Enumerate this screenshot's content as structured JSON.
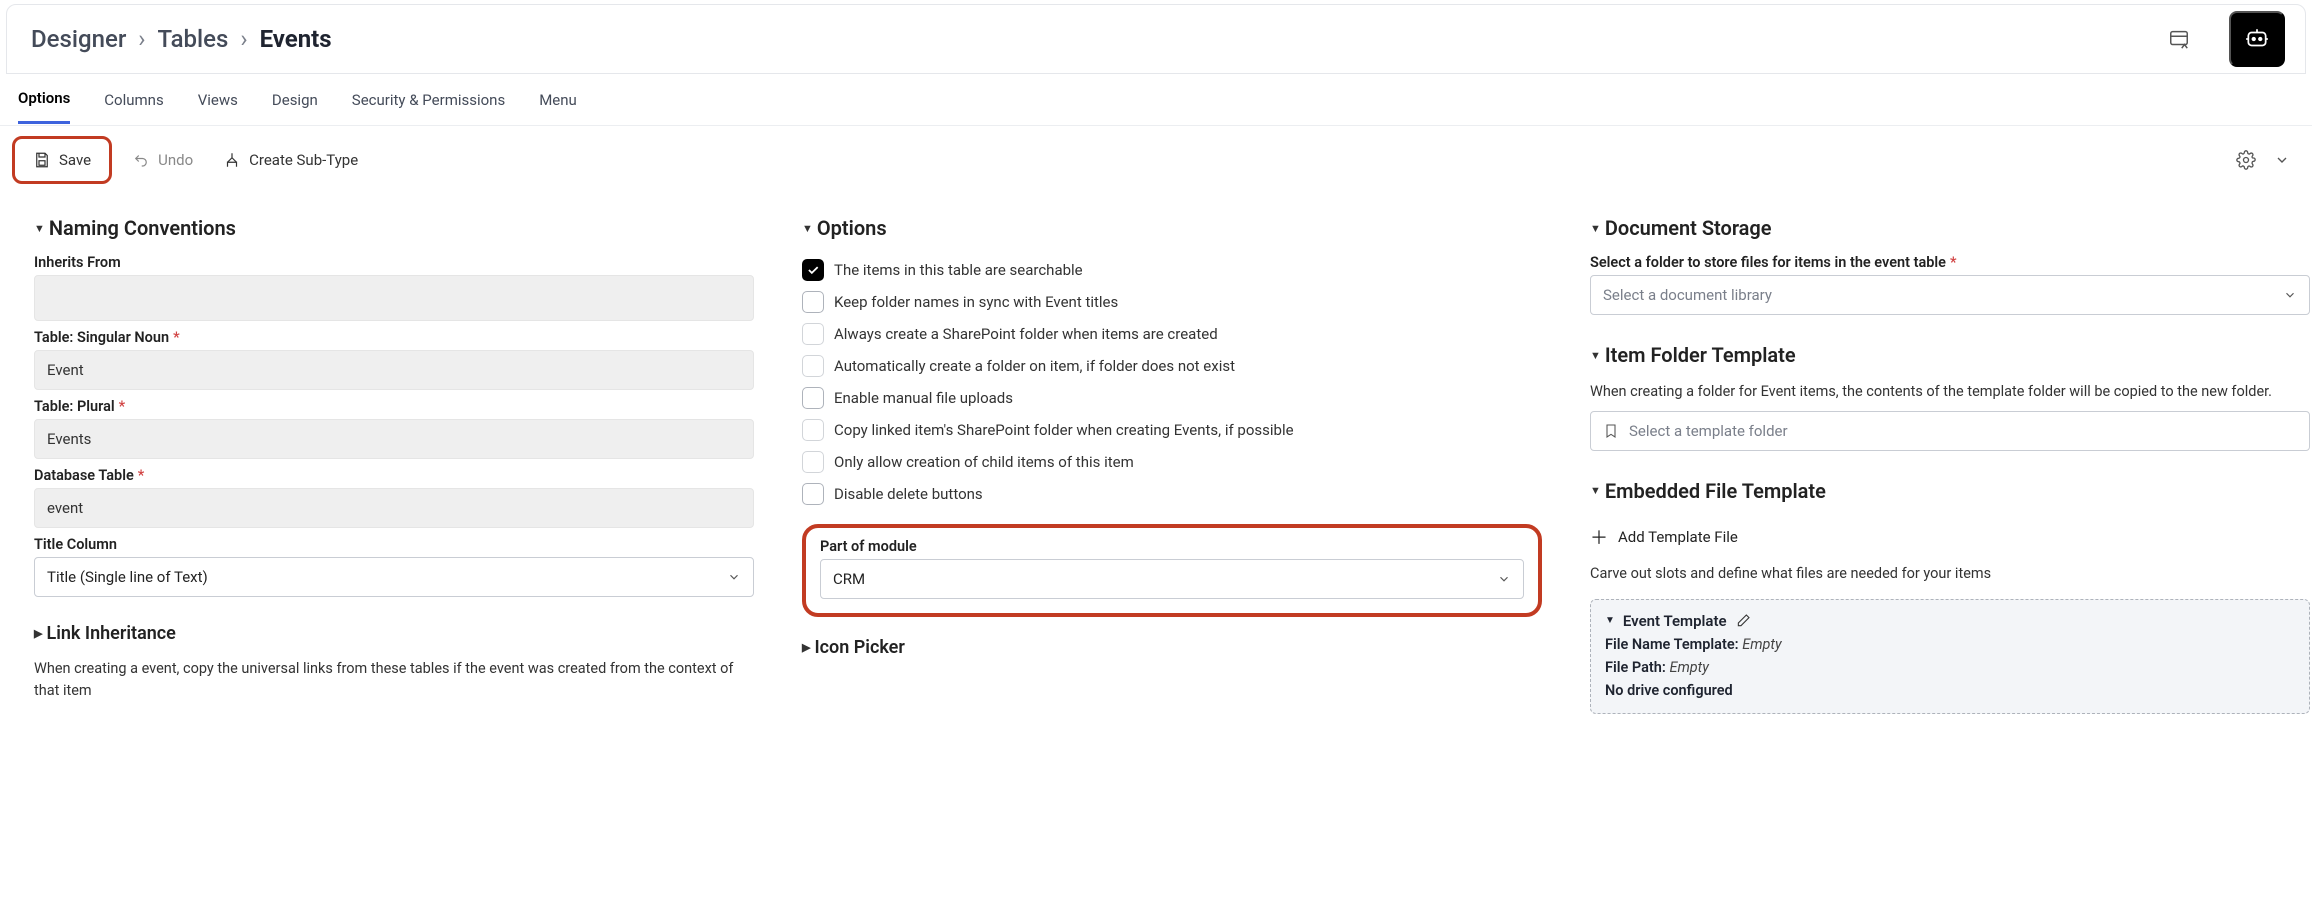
{
  "breadcrumb": {
    "root": "Designer",
    "section": "Tables",
    "current": "Events"
  },
  "tabs": {
    "options": "Options",
    "columns": "Columns",
    "views": "Views",
    "design": "Design",
    "security": "Security & Permissions",
    "menu": "Menu"
  },
  "toolbar": {
    "save": "Save",
    "undo": "Undo",
    "create_subtype": "Create Sub-Type"
  },
  "naming": {
    "title": "Naming Conventions",
    "inherits_label": "Inherits From",
    "singular_label": "Table: Singular Noun",
    "singular_value": "Event",
    "plural_label": "Table: Plural",
    "plural_value": "Events",
    "db_label": "Database Table",
    "db_value": "event",
    "title_col_label": "Title Column",
    "title_col_value": "Title (Single line of Text)"
  },
  "link_inh": {
    "title": "Link Inheritance",
    "desc": "When creating a event, copy the universal links from these tables if the event was created from the context of that item"
  },
  "options": {
    "title": "Options",
    "opt_searchable": "The items in this table are searchable",
    "opt_sync": "Keep folder names in sync with Event titles",
    "opt_always_create": "Always create a SharePoint folder when items are created",
    "opt_auto_create": "Automatically create a folder on item, if folder does not exist",
    "opt_manual_upload": "Enable manual file uploads",
    "opt_copy_linked": "Copy linked item's SharePoint folder when creating Events, if possible",
    "opt_child_only": "Only allow creation of child items of this item",
    "opt_disable_delete": "Disable delete buttons",
    "module_label": "Part of module",
    "module_value": "CRM"
  },
  "icon_picker": {
    "title": "Icon Picker"
  },
  "doc_storage": {
    "title": "Document Storage",
    "folder_label": "Select a folder to store files for items in the event table",
    "folder_placeholder": "Select a document library"
  },
  "item_folder": {
    "title": "Item Folder Template",
    "desc": "When creating a folder for Event items, the contents of the template folder will be copied to the new folder.",
    "placeholder": "Select a template folder"
  },
  "embedded": {
    "title": "Embedded File Template",
    "add_btn": "Add Template File",
    "carve_desc": "Carve out slots and define what files are needed for your items",
    "tpl_title": "Event Template",
    "fn_label": "File Name Template:",
    "fn_value": "Empty",
    "fp_label": "File Path:",
    "fp_value": "Empty",
    "no_drive": "No drive configured"
  }
}
